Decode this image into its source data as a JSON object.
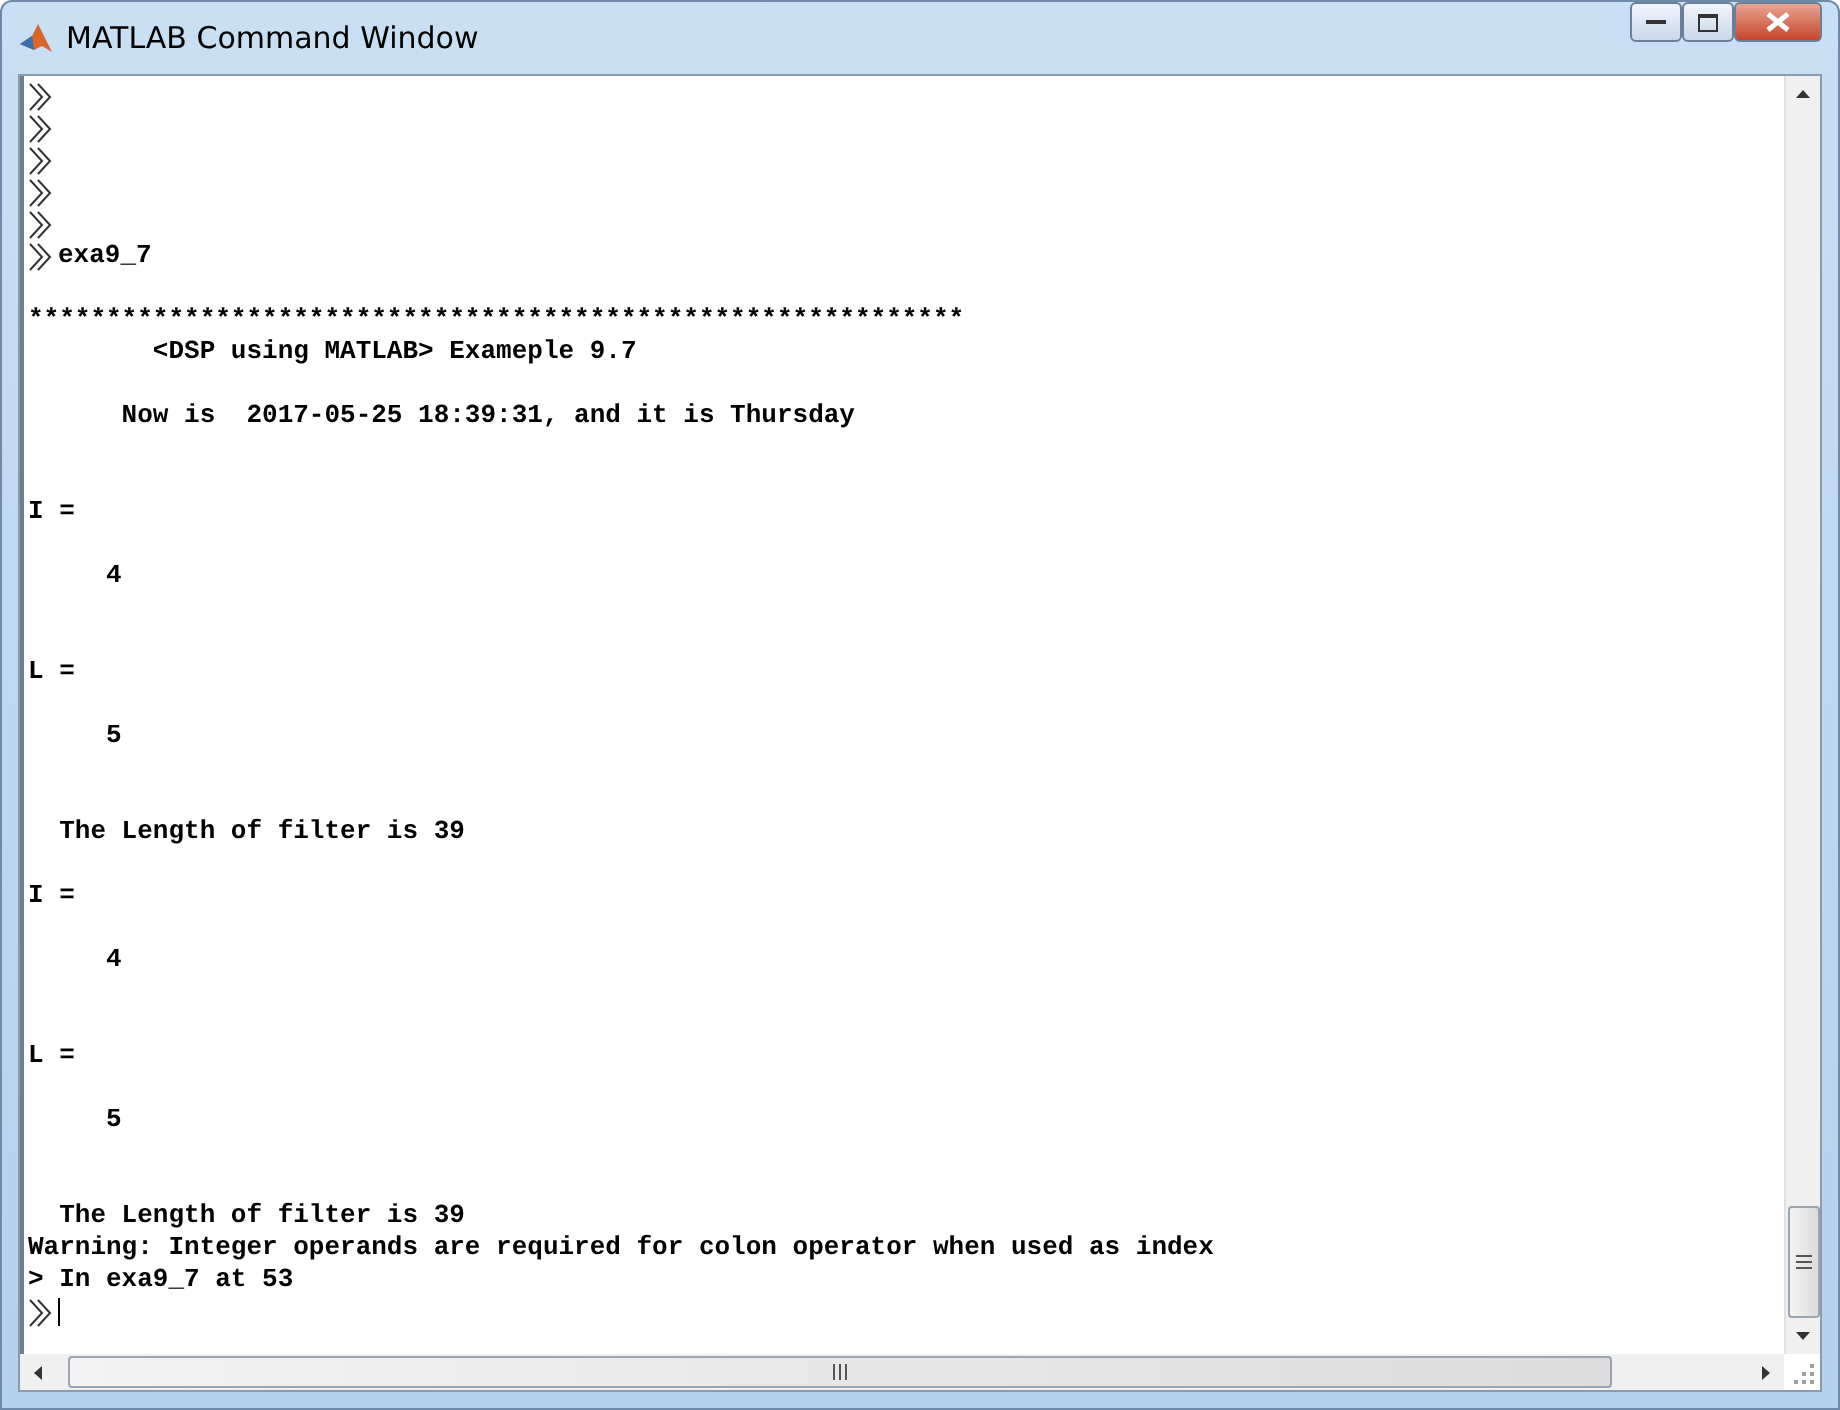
{
  "window": {
    "title": "MATLAB Command Window"
  },
  "console": {
    "lines": [
      {
        "kind": "prompt"
      },
      {
        "kind": "prompt"
      },
      {
        "kind": "prompt"
      },
      {
        "kind": "prompt"
      },
      {
        "kind": "prompt"
      },
      {
        "kind": "prompt",
        "text": "exa9_7"
      },
      {
        "kind": "blank"
      },
      {
        "kind": "text",
        "text": "************************************************************"
      },
      {
        "kind": "text",
        "text": "        <DSP using MATLAB> Exameple 9.7"
      },
      {
        "kind": "blank"
      },
      {
        "kind": "text",
        "text": "      Now is  2017-05-25 18:39:31, and it is Thursday"
      },
      {
        "kind": "blank"
      },
      {
        "kind": "blank"
      },
      {
        "kind": "text",
        "text": "I ="
      },
      {
        "kind": "blank"
      },
      {
        "kind": "text",
        "text": "     4"
      },
      {
        "kind": "blank"
      },
      {
        "kind": "blank"
      },
      {
        "kind": "text",
        "text": "L ="
      },
      {
        "kind": "blank"
      },
      {
        "kind": "text",
        "text": "     5"
      },
      {
        "kind": "blank"
      },
      {
        "kind": "blank"
      },
      {
        "kind": "text",
        "text": "  The Length of filter is 39"
      },
      {
        "kind": "blank"
      },
      {
        "kind": "text",
        "text": "I ="
      },
      {
        "kind": "blank"
      },
      {
        "kind": "text",
        "text": "     4"
      },
      {
        "kind": "blank"
      },
      {
        "kind": "blank"
      },
      {
        "kind": "text",
        "text": "L ="
      },
      {
        "kind": "blank"
      },
      {
        "kind": "text",
        "text": "     5"
      },
      {
        "kind": "blank"
      },
      {
        "kind": "blank"
      },
      {
        "kind": "text",
        "text": "  The Length of filter is 39"
      },
      {
        "kind": "text",
        "text": "Warning: Integer operands are required for colon operator when used as index"
      },
      {
        "kind": "text",
        "text": "> In exa9_7 at 53"
      },
      {
        "kind": "cursor_prompt"
      }
    ]
  }
}
